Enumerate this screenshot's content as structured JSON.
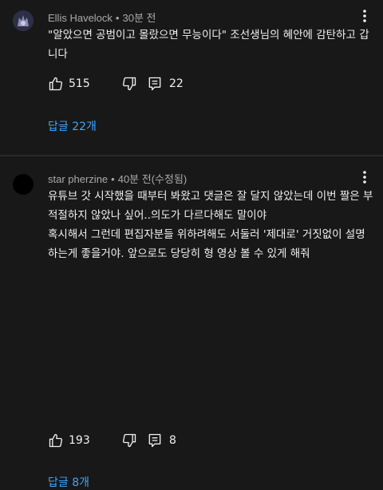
{
  "comments": [
    {
      "author": "Ellis Havelock",
      "separator": "•",
      "time": "30분 전",
      "text": "\"알았으면 공범이고 몰랐으면 무능이다\" 조선생님의 혜안에 감탄하고 갑니다",
      "likes": "515",
      "reply_count": "22",
      "replies_label": "답글 22개"
    },
    {
      "author": "star pherzine",
      "separator": "•",
      "time": "40분 전(수정됨)",
      "text_lines": [
        "유튜브 갓 시작했을 때부터 봐왔고 댓글은 잘 달지 않았는데 이번 짤은 부적절하지 않았나 싶어..의도가 다르다해도 말이야",
        "혹시해서 그런데 편집자분들 위하려해도 서둘러 '제대로' 거짓없이 설명하는게 좋을거야. 앞으로도 당당히 형 영상 볼 수 있게 해줘"
      ],
      "likes": "193",
      "reply_count": "8",
      "replies_label": "답글 8개"
    }
  ],
  "icons": {
    "like": "thumbs-up-icon",
    "dislike": "thumbs-down-icon",
    "reply": "comment-icon",
    "more": "more-vertical-icon"
  },
  "colors": {
    "background": "#181818",
    "text": "#f1f1f1",
    "secondary_text": "#aaaaaa",
    "link": "#3ea6ff"
  }
}
